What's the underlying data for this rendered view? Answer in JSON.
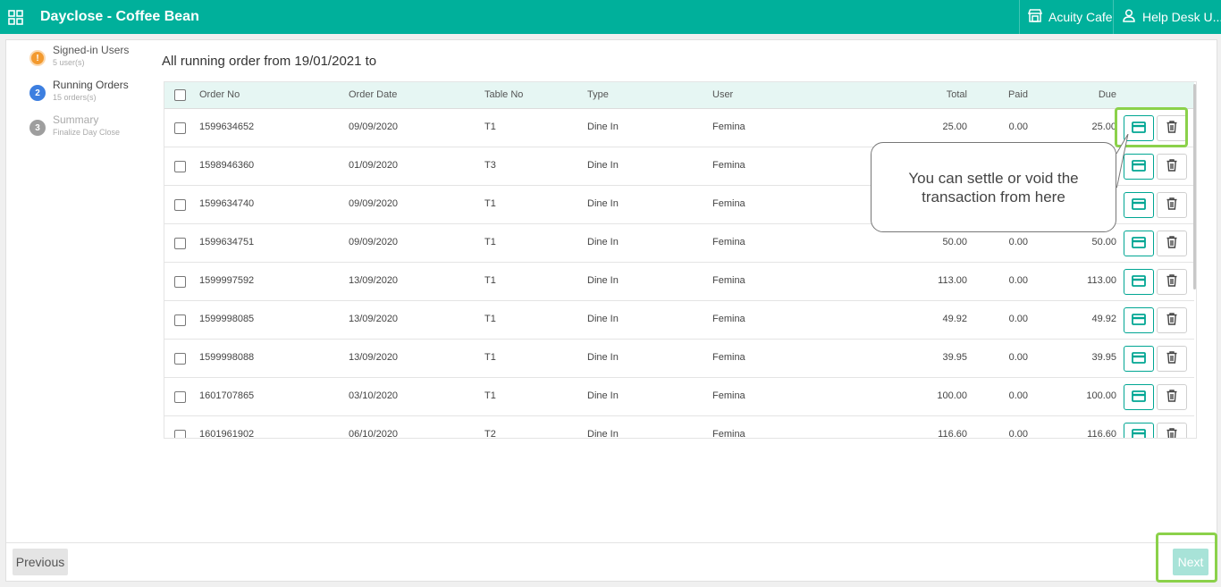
{
  "topbar": {
    "title": "Dayclose - Coffee Bean",
    "store_name": "Acuity Cafe",
    "user_name": "Help Desk U..."
  },
  "steps": [
    {
      "number": "!",
      "label": "Signed-in Users",
      "sub": "5 user(s)",
      "color": "#f39a2f"
    },
    {
      "number": "2",
      "label": "Running Orders",
      "sub": "15 orders(s)",
      "color": "#3d7fe0"
    },
    {
      "number": "3",
      "label": "Summary",
      "sub": "Finalize Day Close",
      "color": "#9e9e9e"
    }
  ],
  "main": {
    "heading": "All running order from 19/01/2021 to"
  },
  "table": {
    "columns": [
      "Order No",
      "Order Date",
      "Table No",
      "Type",
      "User",
      "Total",
      "Paid",
      "Due"
    ],
    "rows": [
      [
        "1599634652",
        "09/09/2020",
        "T1",
        "Dine In",
        "Femina",
        "25.00",
        "0.00",
        "25.00"
      ],
      [
        "1598946360",
        "01/09/2020",
        "T3",
        "Dine In",
        "Femina",
        "",
        "",
        ""
      ],
      [
        "1599634740",
        "09/09/2020",
        "T1",
        "Dine In",
        "Femina",
        "",
        "",
        ""
      ],
      [
        "1599634751",
        "09/09/2020",
        "T1",
        "Dine In",
        "Femina",
        "50.00",
        "0.00",
        "50.00"
      ],
      [
        "1599997592",
        "13/09/2020",
        "T1",
        "Dine In",
        "Femina",
        "113.00",
        "0.00",
        "113.00"
      ],
      [
        "1599998085",
        "13/09/2020",
        "T1",
        "Dine In",
        "Femina",
        "49.92",
        "0.00",
        "49.92"
      ],
      [
        "1599998088",
        "13/09/2020",
        "T1",
        "Dine In",
        "Femina",
        "39.95",
        "0.00",
        "39.95"
      ],
      [
        "1601707865",
        "03/10/2020",
        "T1",
        "Dine In",
        "Femina",
        "100.00",
        "0.00",
        "100.00"
      ],
      [
        "1601961902",
        "06/10/2020",
        "T2",
        "Dine In",
        "Femina",
        "116.60",
        "0.00",
        "116.60"
      ]
    ]
  },
  "callout": {
    "text": "You can settle or void the transaction from here"
  },
  "footer": {
    "previous_label": "Previous",
    "next_label": "Next"
  },
  "icons": {
    "menu": "grid-icon",
    "store": "store-icon",
    "user": "user-icon",
    "settle": "credit-card-icon",
    "void": "trash-icon"
  },
  "colors": {
    "brand": "#00b09b",
    "highlight": "#8bd14a",
    "next_disabled": "#a8e3d8"
  }
}
